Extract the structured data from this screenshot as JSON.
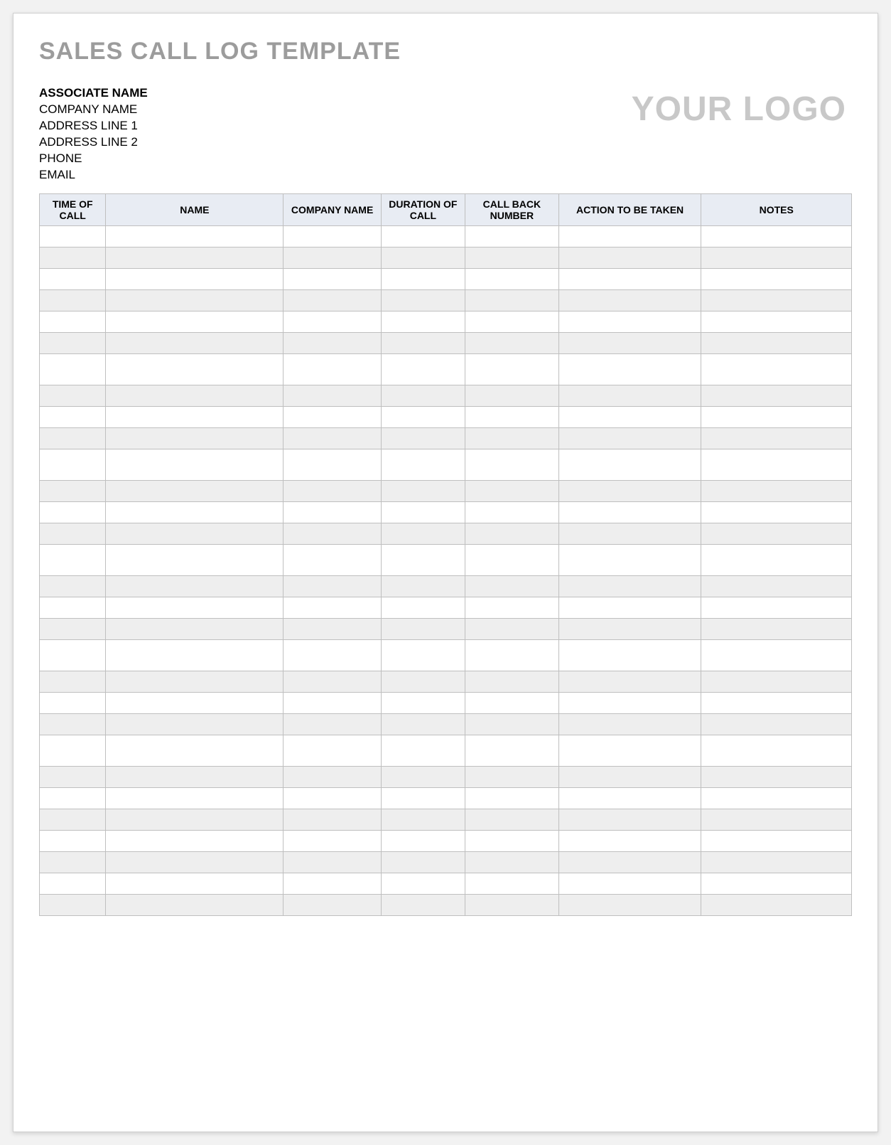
{
  "title": "SALES CALL LOG TEMPLATE",
  "associate": {
    "name_label": "ASSOCIATE NAME",
    "company": "COMPANY NAME",
    "address1": "ADDRESS LINE 1",
    "address2": "ADDRESS LINE 2",
    "phone": "PHONE",
    "email": "EMAIL"
  },
  "logo": "YOUR LOGO",
  "table": {
    "headers": {
      "time": "TIME OF CALL",
      "name": "NAME",
      "company": "COMPANY NAME",
      "duration": "DURATION OF CALL",
      "callback": "CALL BACK NUMBER",
      "action": "ACTION TO BE TAKEN",
      "notes": "NOTES"
    },
    "row_count": 30,
    "tall_rows": [
      6,
      10,
      14,
      18,
      22
    ]
  }
}
